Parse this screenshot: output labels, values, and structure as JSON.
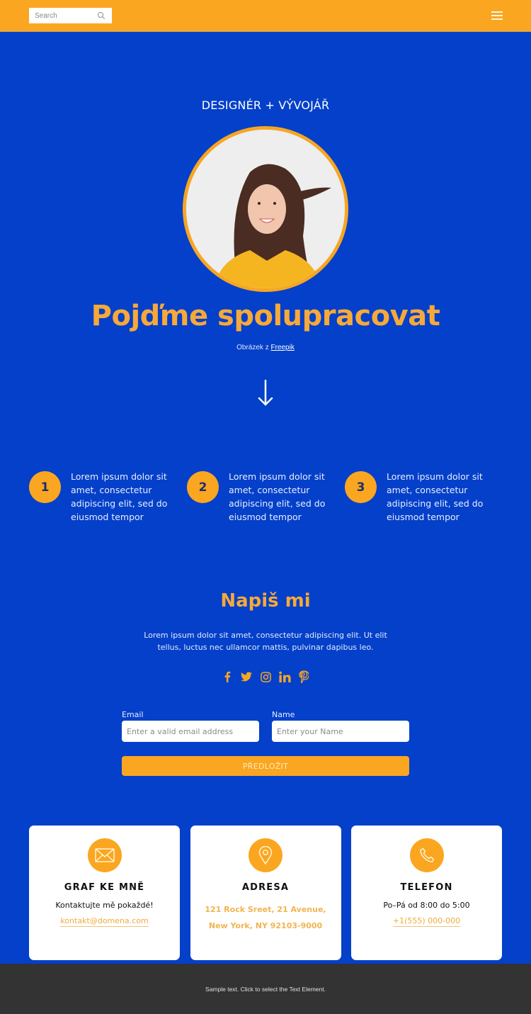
{
  "header": {
    "search_placeholder": "Search",
    "brand_color": "#fba620"
  },
  "hero": {
    "subtitle": "DESIGNÉR + VÝVOJÁŘ",
    "avatar_alt": "Smiling woman in yellow shirt",
    "headline": "Pojďme spolupracovat",
    "credit_prefix": "Obrázek z ",
    "credit_link": "Freepik"
  },
  "steps": [
    {
      "number": "1",
      "text": "Lorem ipsum dolor sit amet, consectetur adipiscing elit, sed do eiusmod tempor"
    },
    {
      "number": "2",
      "text": "Lorem ipsum dolor sit amet, consectetur adipiscing elit, sed do eiusmod tempor"
    },
    {
      "number": "3",
      "text": "Lorem ipsum dolor sit amet, consectetur adipiscing elit, sed do eiusmod tempor"
    }
  ],
  "contact": {
    "title": "Napiš mi",
    "text": "Lorem ipsum dolor sit amet, consectetur adipiscing elit. Ut elit tellus, luctus nec ullamcor mattis, pulvinar dapibus leo.",
    "socials": [
      "facebook",
      "twitter",
      "instagram",
      "linkedin",
      "pinterest"
    ]
  },
  "form": {
    "email_label": "Email",
    "email_placeholder": "Enter a valid email address",
    "name_label": "Name",
    "name_placeholder": "Enter your Name",
    "submit_label": "PŘEDLOŽIT"
  },
  "cards": [
    {
      "icon": "envelope",
      "title": "GRAF KE MNĚ",
      "line": "Kontaktujte mě pokaždé!",
      "link": "kontakt@domena.com"
    },
    {
      "icon": "map-pin",
      "title": "ADRESA",
      "address_1": "121 Rock Sreet, 21 Avenue,",
      "address_2": "New York, NY 92103-9000"
    },
    {
      "icon": "phone",
      "title": "TELEFON",
      "line": "Po–Pá od 8:00 do 5:00",
      "link": "+1(555) 000-000"
    }
  ],
  "footer": {
    "text": "Sample text. Click to select the Text Element."
  }
}
